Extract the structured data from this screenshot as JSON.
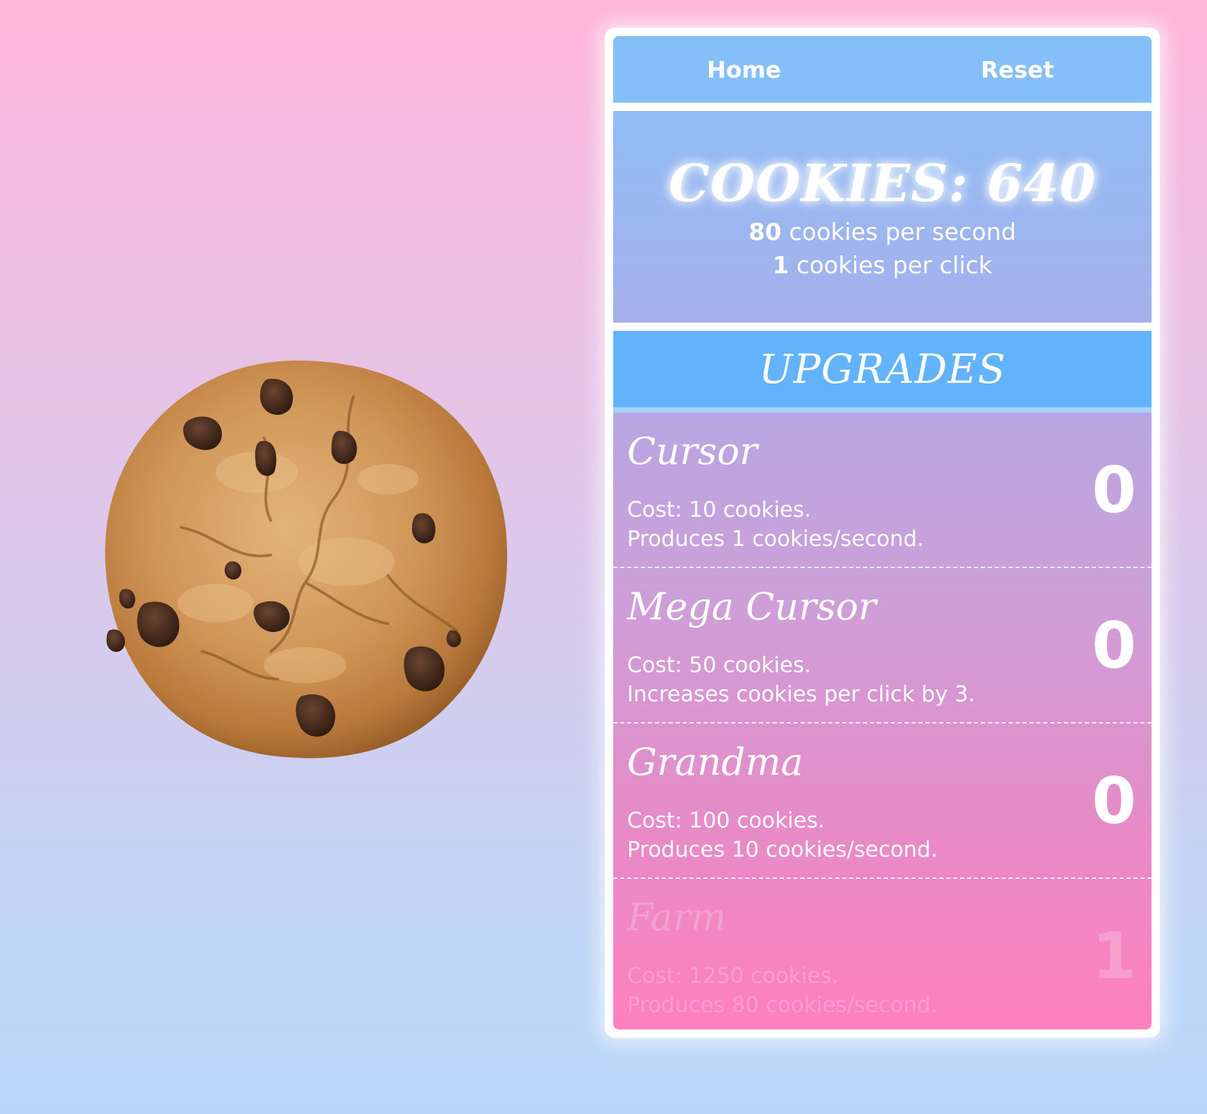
{
  "nav": {
    "home_label": "Home",
    "reset_label": "Reset"
  },
  "stats": {
    "cookies_text": "COOKIES: 640",
    "cookies_per_second": "80",
    "cookies_per_second_suffix": " cookies per second",
    "cookies_per_click": "1",
    "cookies_per_click_suffix": " cookies per click"
  },
  "upgrades": {
    "title": "UPGRADES",
    "items": [
      {
        "name": "Cursor",
        "cost": "Cost: 10 cookies.",
        "effect": "Produces 1 cookies/second.",
        "owned": "0",
        "locked": false
      },
      {
        "name": "Mega Cursor",
        "cost": "Cost: 50 cookies.",
        "effect": "Increases cookies per click by 3.",
        "owned": "0",
        "locked": false
      },
      {
        "name": "Grandma",
        "cost": "Cost: 100 cookies.",
        "effect": "Produces 10 cookies/second.",
        "owned": "0",
        "locked": false
      },
      {
        "name": "Farm",
        "cost": "Cost: 1250 cookies.",
        "effect": "Produces 80 cookies/second.",
        "owned": "1",
        "locked": true
      }
    ]
  },
  "colors": {
    "nav_bg": "#85bff8",
    "upgrades_header_bg": "#63b3fc",
    "cookie_dough": "#c98e4f",
    "chocolate_chip": "#3a2214"
  },
  "icons": {
    "cookie": "chocolate-chip-cookie-icon"
  }
}
